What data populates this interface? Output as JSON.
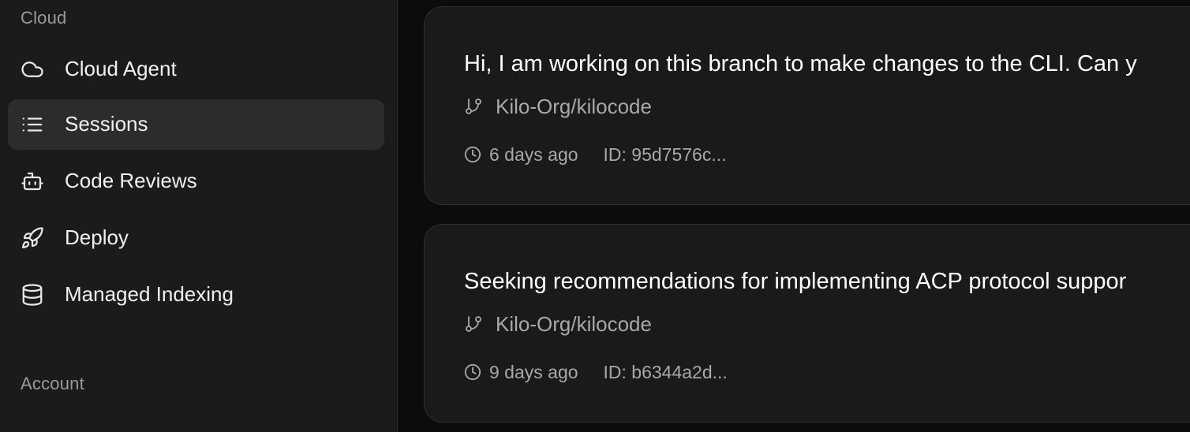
{
  "sidebar": {
    "sections": {
      "cloud": "Cloud",
      "account": "Account"
    },
    "items": [
      {
        "label": "Cloud Agent",
        "icon": "cloud-icon",
        "active": false
      },
      {
        "label": "Sessions",
        "icon": "list-icon",
        "active": true
      },
      {
        "label": "Code Reviews",
        "icon": "bot-icon",
        "active": false
      },
      {
        "label": "Deploy",
        "icon": "rocket-icon",
        "active": false
      },
      {
        "label": "Managed Indexing",
        "icon": "database-icon",
        "active": false
      }
    ]
  },
  "sessions": [
    {
      "title": "Hi, I am working on this branch to make changes to the CLI. Can y",
      "repo": "Kilo-Org/kilocode",
      "time": "6 days ago",
      "id": "ID: 95d7576c..."
    },
    {
      "title": "Seeking recommendations for implementing ACP protocol suppor",
      "repo": "Kilo-Org/kilocode",
      "time": "9 days ago",
      "id": "ID: b6344a2d..."
    }
  ],
  "colors": {
    "sidebar_bg": "#1b1b1b",
    "active_item_bg": "#2c2c2c",
    "main_bg": "#0c0c0c",
    "card_bg": "#1a1a1a",
    "muted_text": "#a8a8a8"
  }
}
